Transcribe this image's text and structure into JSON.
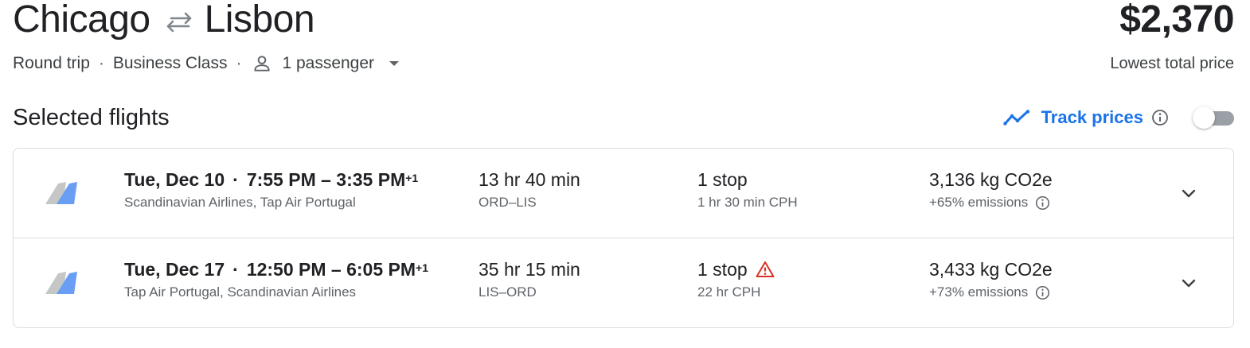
{
  "header": {
    "origin": "Chicago",
    "destination": "Lisbon",
    "price": "$2,370",
    "price_caption": "Lowest total price",
    "trip_type": "Round trip",
    "cabin_class": "Business Class",
    "passengers": "1 passenger"
  },
  "section": {
    "title": "Selected flights",
    "track_label": "Track prices",
    "track_enabled": false
  },
  "flights": [
    {
      "date": "Tue, Dec 10",
      "time_range": "7:55 PM – 3:35 PM",
      "day_offset": "+1",
      "airlines": "Scandinavian Airlines, Tap Air Portugal",
      "duration": "13 hr 40 min",
      "route": "ORD–LIS",
      "stops": "1 stop",
      "stop_warning": false,
      "layover": "1 hr 30 min CPH",
      "co2": "3,136 kg CO2e",
      "emissions": "+65% emissions"
    },
    {
      "date": "Tue, Dec 17",
      "time_range": "12:50 PM – 6:05 PM",
      "day_offset": "+1",
      "airlines": "Tap Air Portugal, Scandinavian Airlines",
      "duration": "35 hr 15 min",
      "route": "LIS–ORD",
      "stops": "1 stop",
      "stop_warning": true,
      "layover": "22 hr CPH",
      "co2": "3,433 kg CO2e",
      "emissions": "+73% emissions"
    }
  ],
  "colors": {
    "accent": "#1a73e8",
    "warning": "#d93025",
    "text_primary": "#202124",
    "text_secondary": "#5f6368",
    "border": "#dadce0"
  },
  "icons": {
    "swap": "swap-arrows-icon",
    "person": "person-icon",
    "dropdown": "caret-down-icon",
    "track": "trending-line-icon",
    "info": "info-icon",
    "warning": "warning-triangle-icon",
    "expand": "chevron-down-icon",
    "airline": "multi-airline-tail-icon"
  }
}
